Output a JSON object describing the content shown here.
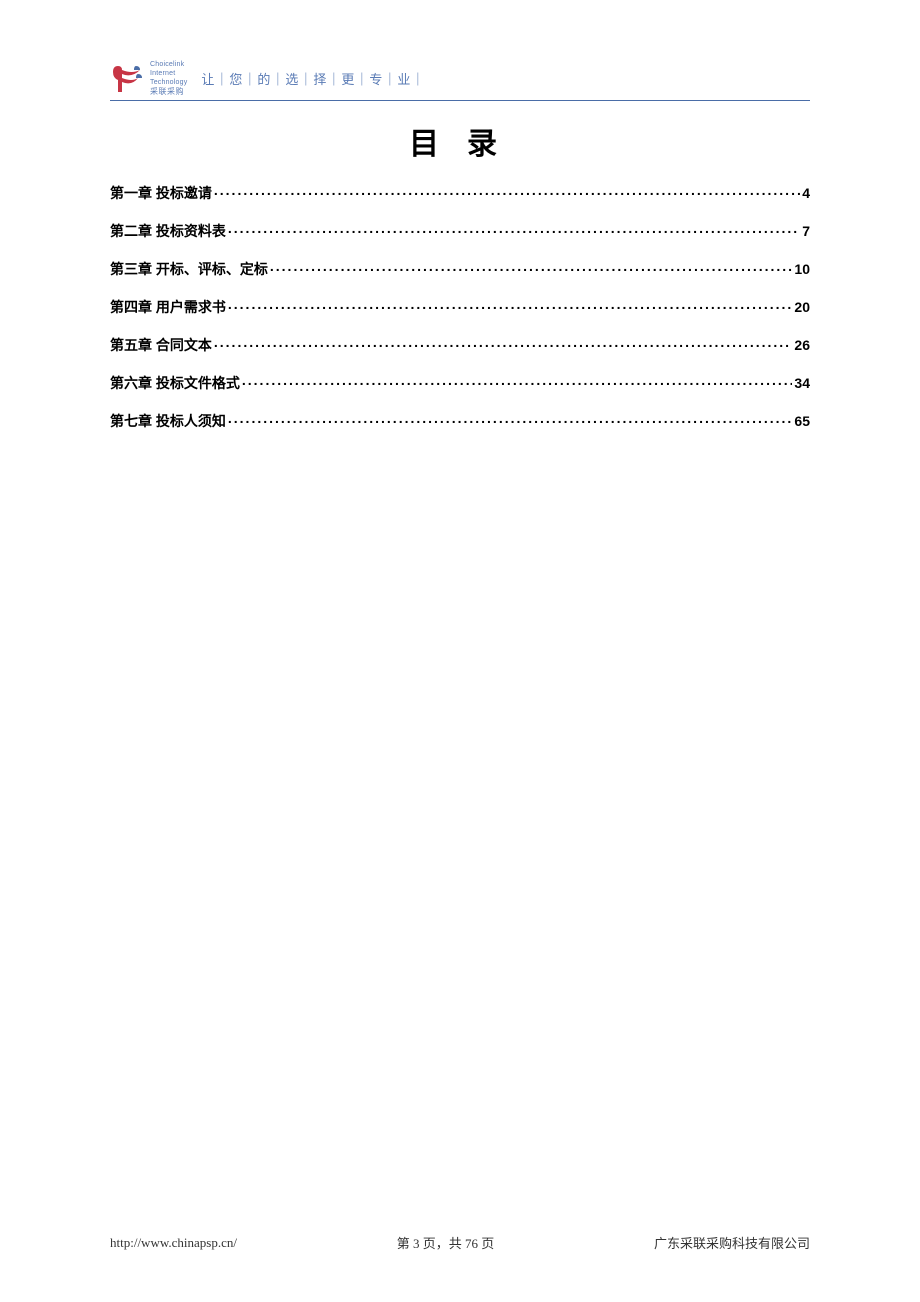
{
  "header": {
    "logo": {
      "en_line1": "Choicelink",
      "en_line2": "Internet",
      "en_line3": "Technology",
      "cn": "采联采购"
    },
    "slogan": "让｜您｜的｜选｜择｜更｜专｜业｜"
  },
  "title": "目录",
  "toc": [
    {
      "label": "第一章 投标邀请",
      "page": "4"
    },
    {
      "label": "第二章 投标资料表",
      "page": "7"
    },
    {
      "label": "第三章 开标、评标、定标",
      "page": "10"
    },
    {
      "label": "第四章 用户需求书",
      "page": "20"
    },
    {
      "label": "第五章 合同文本",
      "page": "26"
    },
    {
      "label": "第六章 投标文件格式",
      "page": "34"
    },
    {
      "label": "第七章 投标人须知",
      "page": "65"
    }
  ],
  "footer": {
    "url": "http://www.chinapsp.cn/",
    "page_info": "第 3 页，共 76 页",
    "company": "广东采联采购科技有限公司"
  }
}
